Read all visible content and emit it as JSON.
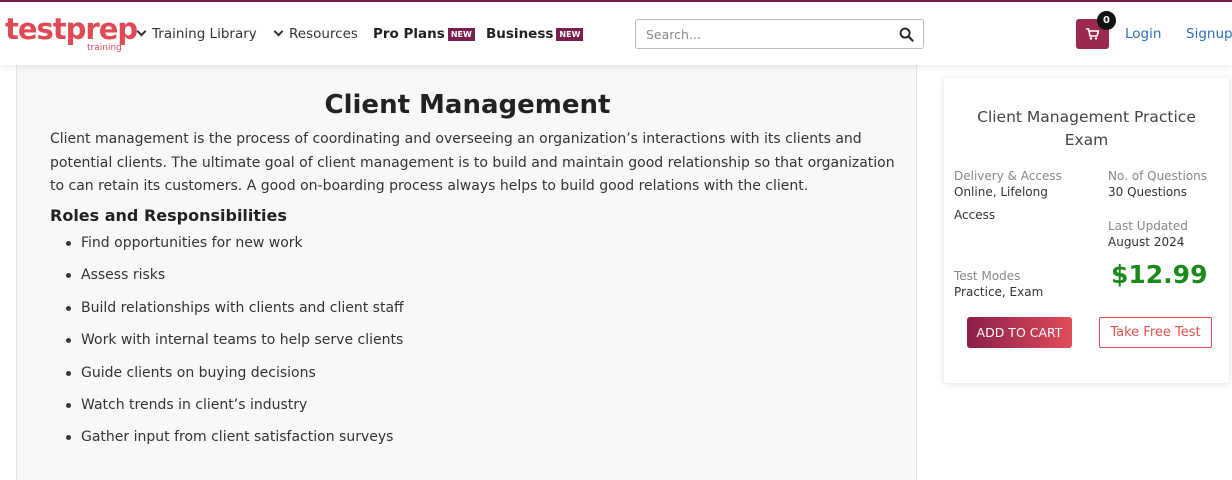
{
  "brand": {
    "logo_main": "testprep",
    "logo_sub": "training",
    "colors": {
      "accent": "#e04a57",
      "brand": "#7b1e4d",
      "link": "#2d6fb4",
      "price": "#1a8a1a"
    }
  },
  "nav": {
    "training_library": "Training Library",
    "resources": "Resources",
    "pro_plans": "Pro Plans",
    "business": "Business",
    "new_badge": "NEW"
  },
  "search": {
    "placeholder": "Search...",
    "value": "",
    "icon": "search-icon"
  },
  "account": {
    "cart_count": "0",
    "cart_icon": "cart-icon",
    "login": "Login",
    "signup": "Signup"
  },
  "article": {
    "title": "Client Management",
    "intro": "Client management is the process of coordinating and overseeing an organization’s interactions with its clients and potential clients. The ultimate goal of client management is to build and maintain good relationship so that organization to can retain its customers. A good on-boarding process always helps to build good relations with the client.",
    "section_heading": "Roles and Responsibilities",
    "responsibilities": [
      "Find opportunities for new work",
      "Assess risks",
      "Build relationships with clients and client staff",
      "Work with internal teams to help serve clients",
      "Guide clients on buying decisions",
      "Watch trends in client’s industry",
      "Gather input from client satisfaction surveys"
    ]
  },
  "product": {
    "title": "Client Management Practice Exam",
    "delivery_label": "Delivery & Access",
    "delivery_value_line1": "Online, Lifelong",
    "delivery_value_line2": "Access",
    "questions_label": "No. of Questions",
    "questions_value": "30 Questions",
    "updated_label": "Last Updated",
    "updated_value": "August 2024",
    "modes_label": "Test Modes",
    "modes_value": "Practice, Exam",
    "price": "$12.99",
    "add_to_cart": "ADD TO CART",
    "take_free_test": "Take Free Test"
  }
}
